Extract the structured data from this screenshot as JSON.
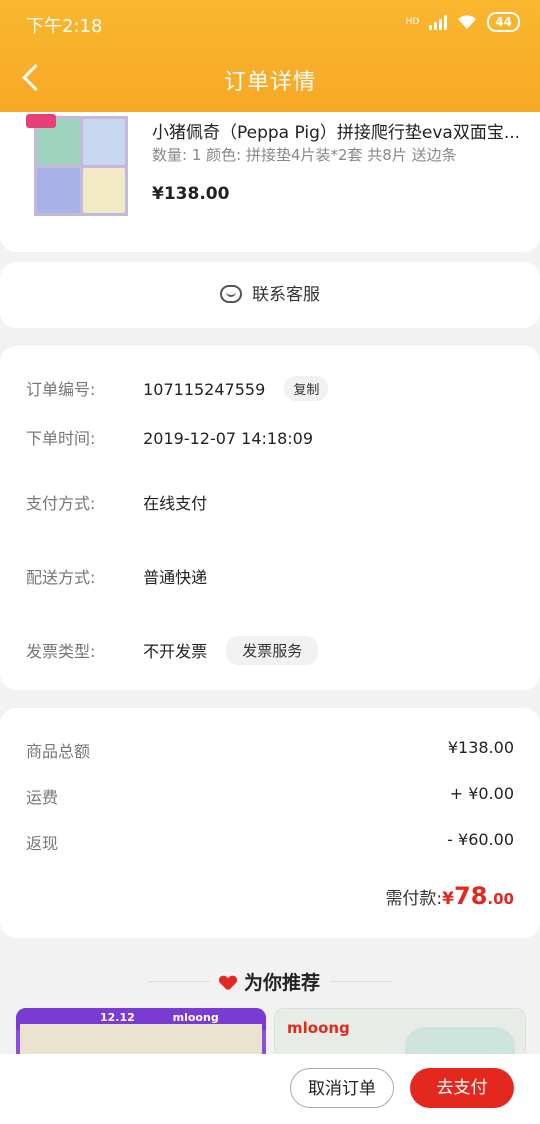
{
  "status": {
    "time": "下午2:18",
    "battery": "44",
    "net": "HD"
  },
  "header": {
    "title": "订单详情"
  },
  "product": {
    "title": "小猪佩奇（Peppa Pig）拼接爬行垫eva双面宝...",
    "spec": "数量: 1   颜色: 拼接垫4片装*2套 共8片 送边条",
    "price": "¥138.00"
  },
  "service": {
    "label": "联系客服"
  },
  "order_info": {
    "rows": [
      {
        "label": "订单编号:",
        "value": "107115247559",
        "action": "复制"
      },
      {
        "label": "下单时间:",
        "value": "2019-12-07 14:18:09"
      },
      {
        "label": "支付方式:",
        "value": "在线支付"
      },
      {
        "label": "配送方式:",
        "value": "普通快递"
      },
      {
        "label": "发票类型:",
        "value": "不开发票",
        "action": "发票服务"
      }
    ]
  },
  "amounts": {
    "rows": [
      {
        "label": "商品总额",
        "value": "¥138.00"
      },
      {
        "label": "运费",
        "value": "+ ¥0.00"
      },
      {
        "label": "返现",
        "value": "- ¥60.00"
      }
    ],
    "total_label": "需付款:",
    "total_symbol": "¥",
    "total_int": "78",
    "total_dec": ".00"
  },
  "recommend": {
    "title": "为你推荐",
    "items": [
      {
        "badge": "12.12",
        "brand": "mloong"
      },
      {
        "brand": "mloong"
      }
    ]
  },
  "actions": {
    "cancel": "取消订单",
    "pay": "去支付"
  },
  "colors": {
    "header": "#f7a827",
    "accent": "#e4281e"
  }
}
